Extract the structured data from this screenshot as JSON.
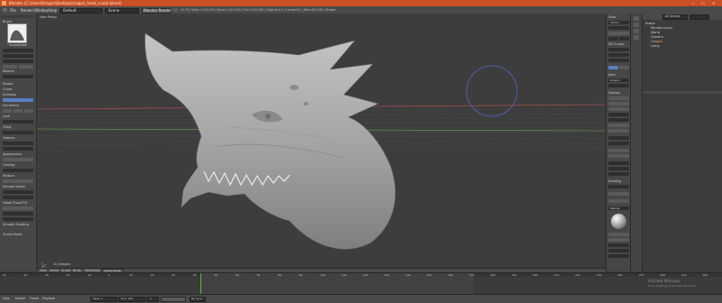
{
  "window": {
    "title": "Blender  [C:\\Users\\Dragon\\Desktop\\dragon_head_sculpt.blend]",
    "controls": [
      "—",
      "☐",
      "✕"
    ]
  },
  "menubar": {
    "items": [
      "File",
      "Render",
      "Window",
      "Help"
    ],
    "layout": "Default",
    "scene": "Scene",
    "engine": "Blender Render",
    "stats": "v2.79 | Verts:1,210,476 | Faces:1,210,240 | Tris:2,420,480 | Objects:1/3 | Lamps:0/1 | Mem:612.4M | Dragon"
  },
  "tool_shelf": {
    "items": [
      "Brush",
      "Radius",
      "Strength",
      "Autosmooth",
      "Normal",
      "Add",
      "Subtract",
      "Stroke",
      "Curve",
      "Dyntopo",
      "Symmetry",
      "Mirror",
      "X",
      "Y",
      "Z",
      "Lock",
      "Tiling",
      "Options",
      "Appearance",
      "Overlay",
      "Texture",
      "Sample Detail",
      "Detail Flood Fill",
      "Smooth Shading",
      "Sculpt Mode"
    ],
    "brush_name": "SculptDraw"
  },
  "viewport": {
    "view_label": "User Persp",
    "object_label": "(1) Dragon"
  },
  "properties_n": {
    "items": [
      "View",
      "Lens",
      "Lock to Object",
      "Lock to Cursor",
      "Clip",
      "Start",
      "End",
      "3D Cursor",
      "Location",
      "X",
      "Y",
      "Z",
      "Item",
      "Dragon",
      "Display",
      "Shading",
      "Matcap",
      "Backface Culling",
      "Ambient Occlusion",
      "Strength",
      "Distance",
      "Samples"
    ],
    "values": {
      "lens": "35mm",
      "clip_start": "0.1 m",
      "clip_end": "1000 m",
      "x": "0 m",
      "y": "0 m",
      "z": "0 m"
    }
  },
  "outliner": {
    "search_label": "All Scenes",
    "items": [
      "Scene",
      "RenderLayers",
      "World",
      "Camera",
      "Dragon",
      "Lamp"
    ]
  },
  "header_bottom": {
    "items": [
      "View",
      "Select",
      "Sculpt",
      "Brush",
      "Hide/Mask",
      "Sculpt Mode"
    ]
  },
  "timeline": {
    "ticks": [
      "-50",
      "-40",
      "-30",
      "-20",
      "-10",
      "0",
      "10",
      "20",
      "30",
      "40",
      "50",
      "60",
      "70",
      "80",
      "90",
      "100",
      "110",
      "120",
      "130",
      "140",
      "150",
      "160",
      "170",
      "180",
      "190",
      "200",
      "210",
      "220",
      "230",
      "240",
      "250",
      "260",
      "270",
      "280"
    ],
    "footer": [
      "View",
      "Marker",
      "Frame",
      "Playback"
    ],
    "start_label": "Start: 1",
    "end_label": "End: 250",
    "current_label": "1",
    "sync": "No Sync"
  },
  "watermark": {
    "line1": "Activate Windows",
    "line2": "Go to Settings to activate Windows."
  },
  "colors": {
    "titlebar": "#c94f25",
    "panel": "#474747",
    "viewport_bg": "#3d3d3d",
    "sculpt_clay": "#a8a8a8",
    "selection_blue": "#5680c2",
    "x_axis": "#c25050",
    "y_axis": "#6aa74a"
  }
}
